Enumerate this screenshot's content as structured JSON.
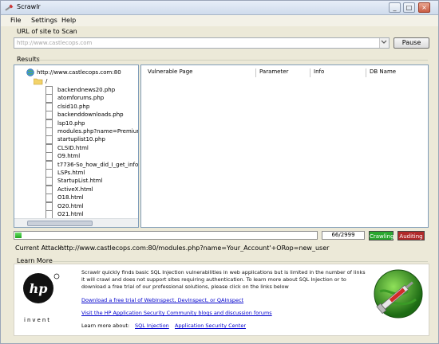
{
  "window": {
    "title": "Scrawlr",
    "controls": [
      "_",
      "□",
      "×"
    ]
  },
  "menu": [
    "File",
    "Settings",
    "Help"
  ],
  "scan": {
    "label": "URL of site to Scan",
    "url": "http://www.castlecops.com",
    "button": "Pause"
  },
  "results": {
    "label": "Results"
  },
  "tree": {
    "root": "http://www.castlecops.com:80",
    "slash": "/",
    "items": [
      "backendnews20.php",
      "atomforums.php",
      "clsid10.php",
      "backenddownloads.php",
      "lsp10.php",
      "modules.php?name=Premium",
      "startuplist10.php",
      "CLSID.html",
      "O9.html",
      "t7736-So_how_did_I_get_info",
      "LSPs.html",
      "StartupList.html",
      "ActiveX.html",
      "O18.html",
      "O20.html",
      "O21.html"
    ]
  },
  "grid": {
    "columns": [
      "Vulnerable Page",
      "Parameter",
      "Info",
      "DB Name"
    ]
  },
  "status": {
    "progress": 0.02,
    "count": "66/2999",
    "crawling": "Crawling",
    "auditing": "Auditing",
    "current_attack_label": "Current Attack:",
    "current_attack": "http://www.castlecops.com:80/modules.php?name=Your_Account'+ORop=new_user"
  },
  "learn": {
    "label": "Learn More",
    "description": "Scrawlr quickly finds basic SQL Injection vulnerabilities in web applications but is limited in the number of links it will crawl and does not support sites requiring authentication. To learn more about SQL Injection or to download a free trial of our professional solutions, please click on the links below",
    "link1": "Download a free trial of WebInspect, DevInspect, or QAInspect",
    "link2": "Visit the HP Application Security Community blogs and discussion forums",
    "learn_about": "Learn more about:",
    "link3": "SQL Injection",
    "link4": "Application Security Center",
    "hp_logo": "hp",
    "hp_text": "invent"
  },
  "colors": {
    "green": "#2aa72f",
    "red": "#b12a2a",
    "link": "#0000cc"
  }
}
